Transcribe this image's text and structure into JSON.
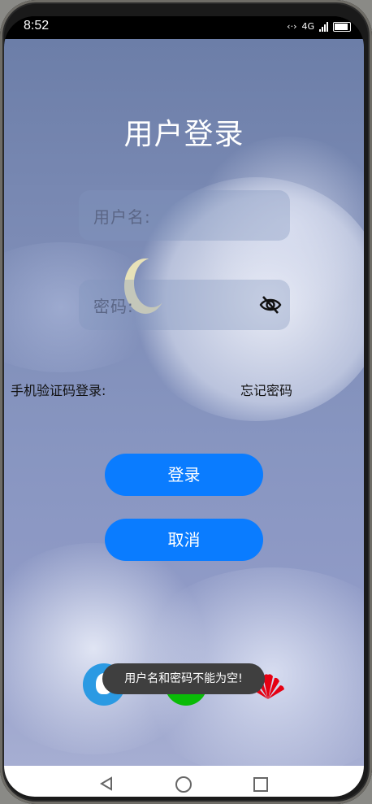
{
  "status_bar": {
    "time": "8:52",
    "data_label": "4G"
  },
  "login": {
    "title": "用户登录",
    "username_label": "用户名:",
    "password_label": "密码:",
    "sms_login_link": "手机验证码登录:",
    "forgot_password_link": "忘记密码",
    "login_button": "登录",
    "cancel_button": "取消"
  },
  "social_icons": [
    "qq-icon",
    "wechat-icon",
    "huawei-icon"
  ],
  "toast": {
    "message": "用户名和密码不能为空!"
  },
  "colors": {
    "primary": "#0a7cff",
    "background": "#7d8cb6",
    "toast": "#3f3f3f"
  },
  "nav": [
    "back-icon",
    "home-icon",
    "recents-icon"
  ]
}
